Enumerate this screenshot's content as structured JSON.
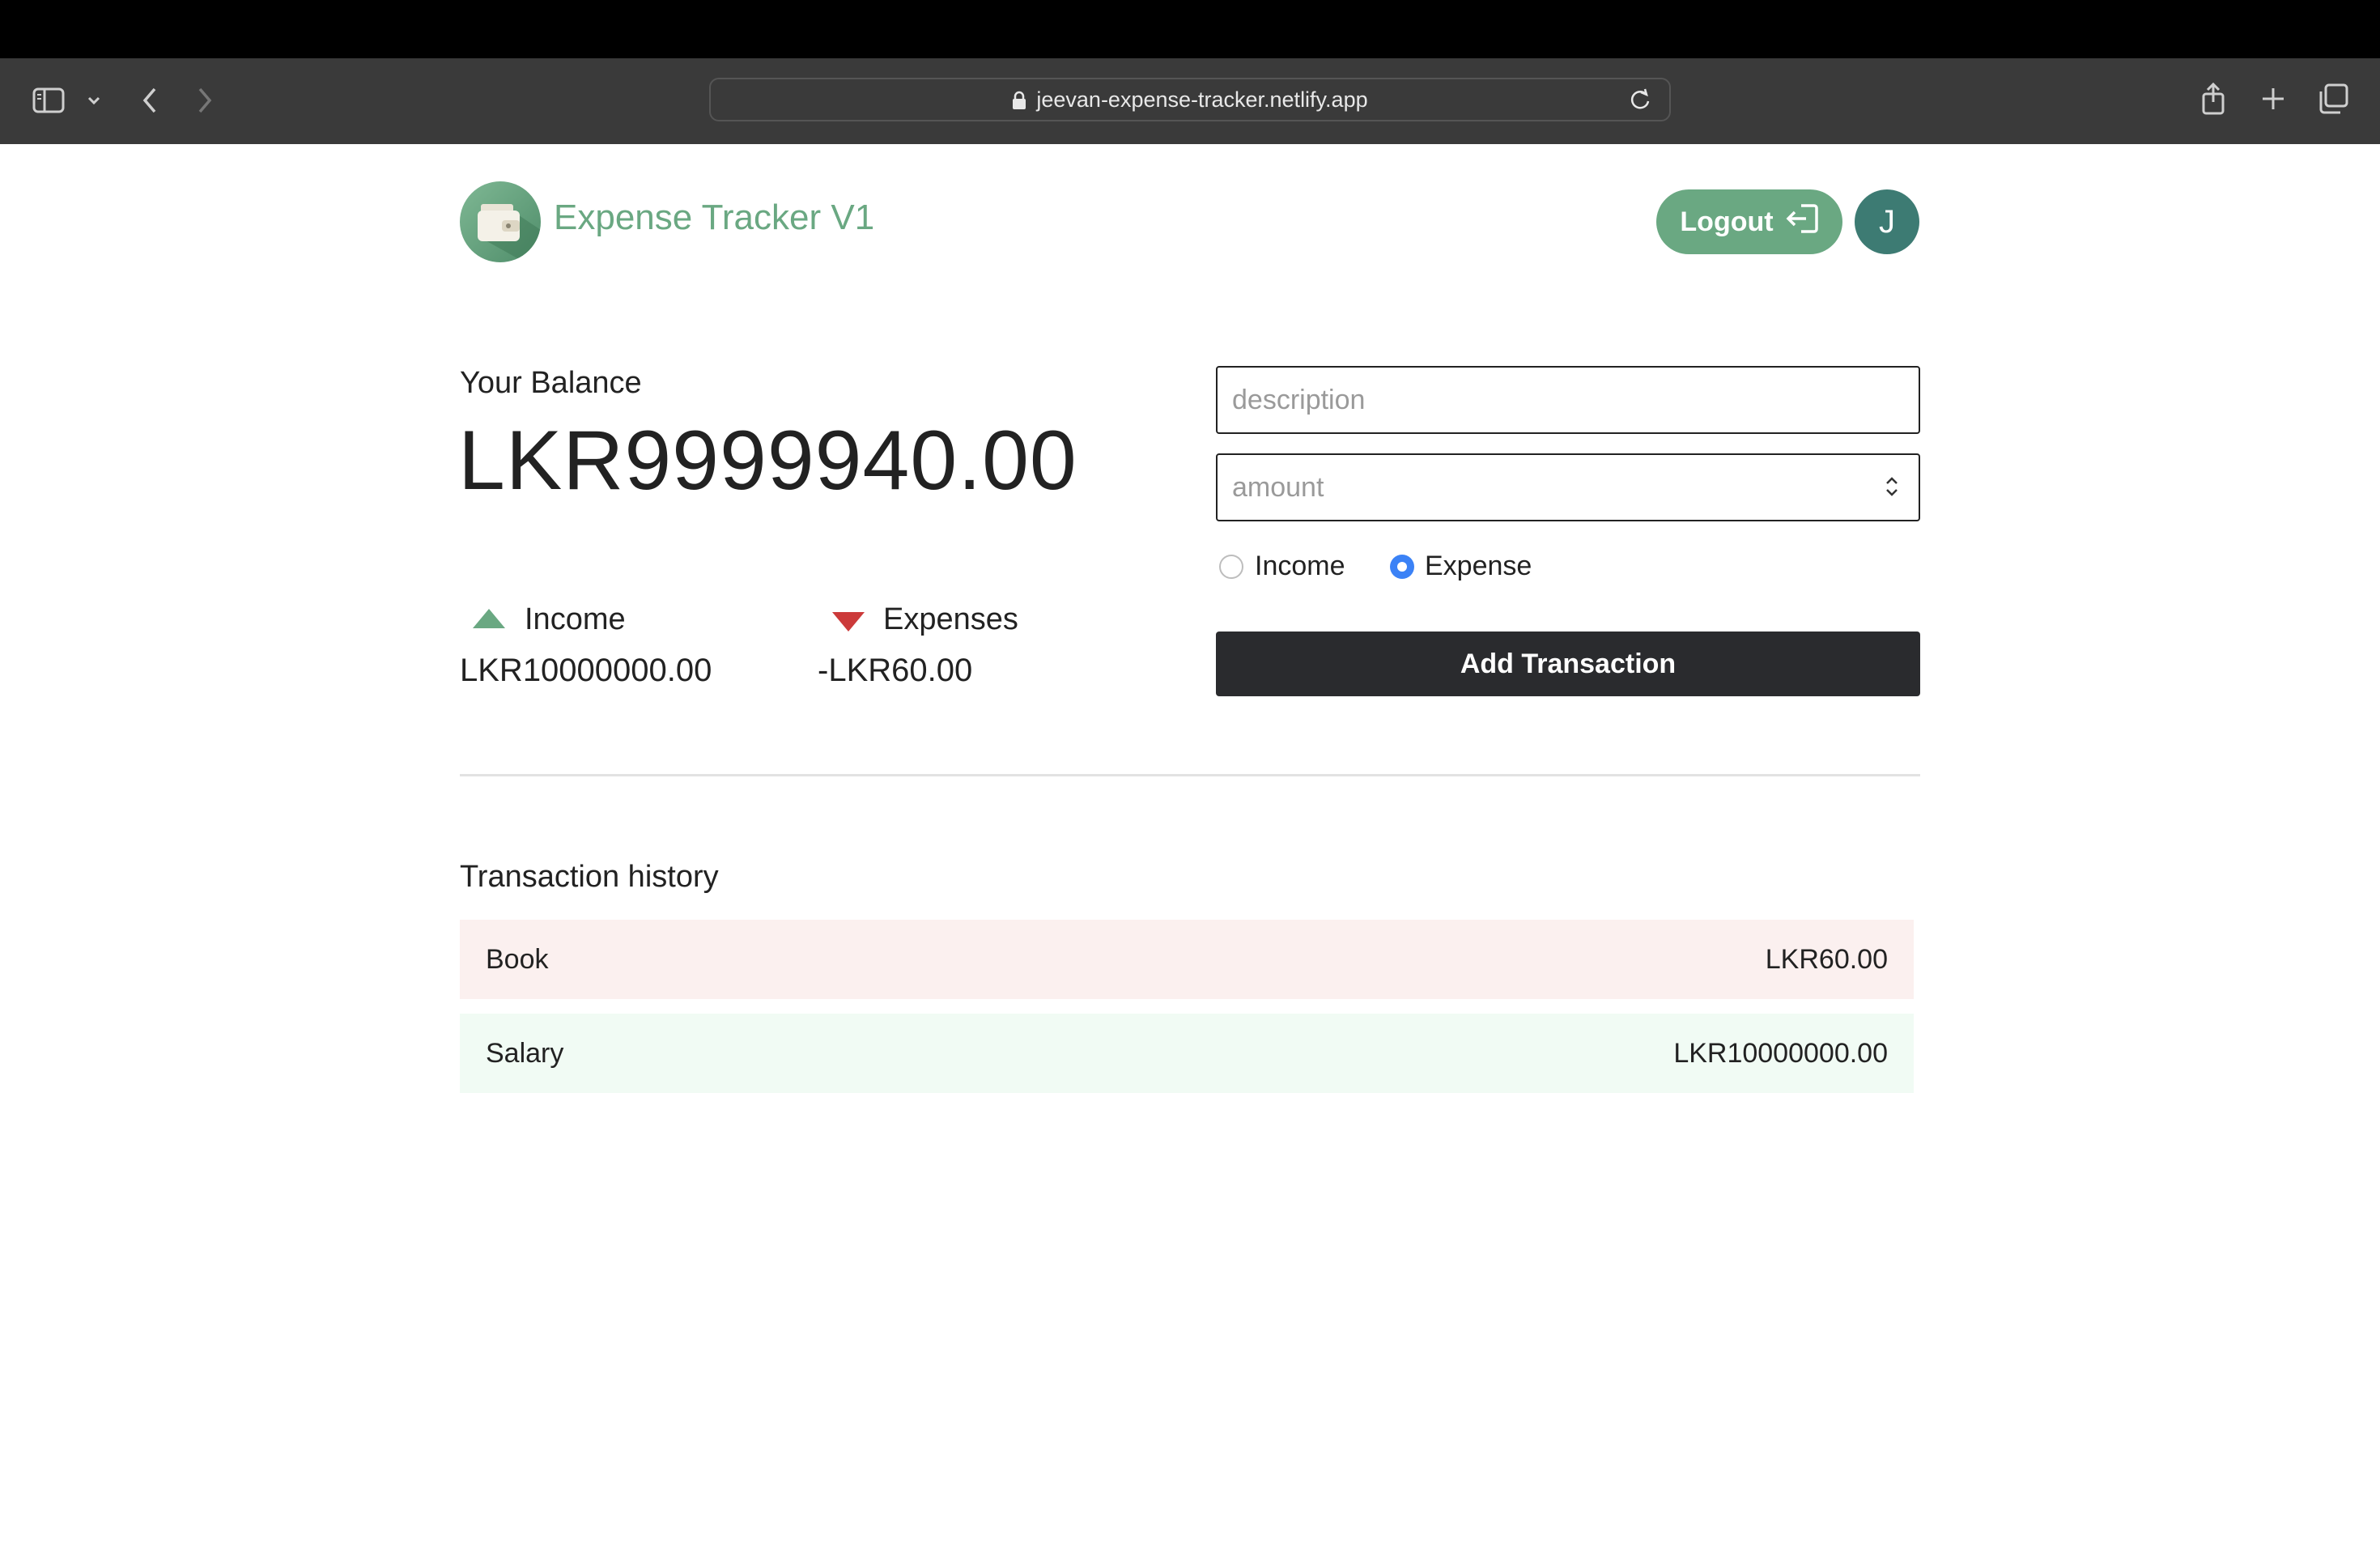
{
  "browser": {
    "url": "jeevan-expense-tracker.netlify.app"
  },
  "header": {
    "title": "Expense Tracker V1",
    "logout_label": "Logout",
    "avatar_initial": "J"
  },
  "balance": {
    "label": "Your Balance",
    "value": "LKR9999940.00"
  },
  "summary": {
    "income_label": "Income",
    "income_value": "LKR10000000.00",
    "expense_label": "Expenses",
    "expense_value": "-LKR60.00"
  },
  "form": {
    "description_placeholder": "description",
    "amount_placeholder": "amount",
    "type_options": [
      "Income",
      "Expense"
    ],
    "selected_type": "Expense",
    "submit_label": "Add Transaction"
  },
  "history": {
    "title": "Transaction history",
    "transactions": [
      {
        "description": "Book",
        "amount": "LKR60.00",
        "type": "expense"
      },
      {
        "description": "Salary",
        "amount": "LKR10000000.00",
        "type": "income"
      }
    ]
  },
  "colors": {
    "brand_green": "#6aa882",
    "expense_red": "#cc3a3a",
    "avatar_teal": "#3d7b73",
    "button_dark": "#2a2b2e",
    "radio_blue": "#3b82f6"
  }
}
